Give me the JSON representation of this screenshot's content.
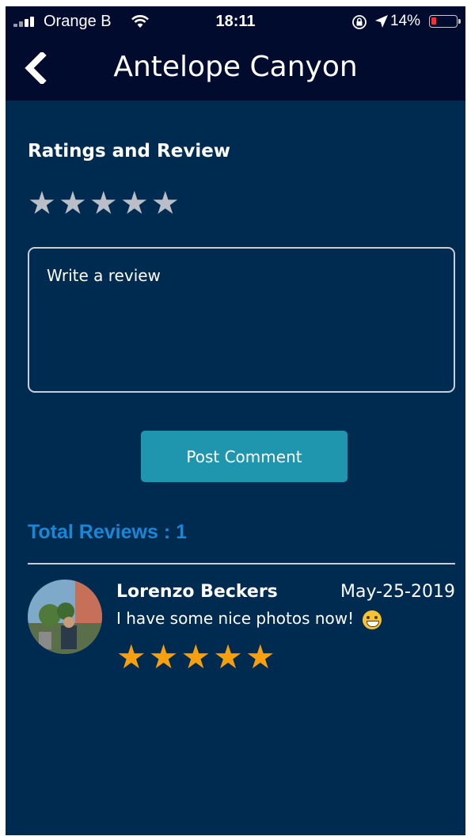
{
  "status_bar": {
    "carrier": "Orange B",
    "time": "18:11",
    "battery": "14%"
  },
  "header": {
    "title": "Antelope Canyon",
    "back_icon": "chevron-left-icon"
  },
  "rating_section": {
    "title": "Ratings and Review",
    "stars": [
      "★",
      "★",
      "★",
      "★",
      "★"
    ],
    "star_color": "#b9bec7",
    "review_placeholder": "Write a review",
    "post_button": "Post Comment"
  },
  "reviews": {
    "total_label": "Total Reviews : 1",
    "items": [
      {
        "name": "Lorenzo Beckers",
        "date": "May-25-2019",
        "text": "I have some nice photos now!",
        "stars": [
          "★",
          "★",
          "★",
          "★",
          "★"
        ],
        "star_color": "#f7a00f"
      }
    ]
  },
  "colors": {
    "background": "#002b50",
    "header": "#000b2e",
    "button": "#1f96ad",
    "accent": "#1a86d6"
  }
}
